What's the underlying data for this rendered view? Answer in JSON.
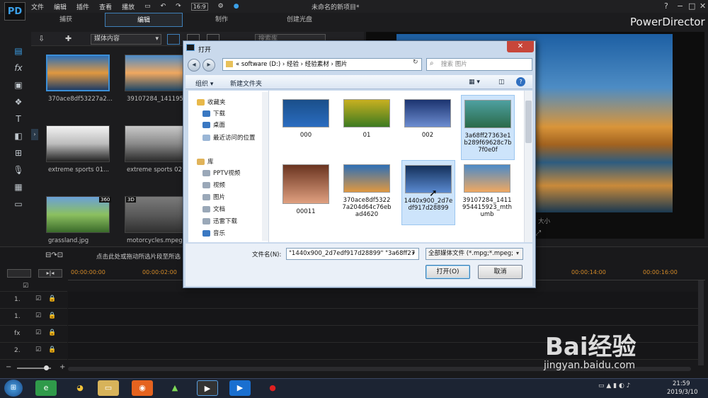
{
  "menubar": {
    "items": [
      "文件",
      "编辑",
      "插件",
      "查看",
      "播放"
    ],
    "title": "未命名的新项目*",
    "zoom_value": "16:9",
    "help": "?",
    "minimize": "−",
    "maximize": "□",
    "close": "✕"
  },
  "modes": [
    "捕获",
    "编辑",
    "制作",
    "创建光盘"
  ],
  "brand": "PowerDirector",
  "library": {
    "filter": "媒体内容",
    "search_placeholder": "搜索库",
    "items": [
      {
        "label": "370ace8df53227a2...",
        "colors": [
          "#2e6fb6",
          "#e09840",
          "#1f3d66"
        ]
      },
      {
        "label": "39107284_1411954...",
        "colors": [
          "#4b8ac8",
          "#f0a860",
          "#1e4666"
        ]
      },
      {
        "label": "extreme sports 01...",
        "colors": [
          "#f2f2f2",
          "#bcbcbc",
          "#222"
        ]
      },
      {
        "label": "extreme sports 02...",
        "colors": [
          "#c9c9c9",
          "#8a8a8a",
          "#2a2a2a"
        ]
      },
      {
        "label": "grassland.jpg",
        "colors": [
          "#6aa0d8",
          "#8cc060",
          "#3a6a2a"
        ]
      },
      {
        "label": "motorcycles.mpeg",
        "colors": [
          "#7a7a7a",
          "#5a5a5a",
          "#303030"
        ]
      }
    ],
    "badges": [
      "360",
      "3D"
    ]
  },
  "preview": {
    "size_label": "大小"
  },
  "timeline": {
    "hint": "点击此处或拖动所选片段至所选",
    "ticks": [
      {
        "label": "00:00:00:00",
        "pos": 0
      },
      {
        "label": "00:00:02:00",
        "pos": 1
      },
      {
        "label": "00:00:14:00",
        "pos": 7
      },
      {
        "label": "00:00:16:00",
        "pos": 8
      }
    ],
    "tracks": [
      "1.",
      "1.",
      "fx",
      "2."
    ]
  },
  "dialog": {
    "title": "打开",
    "address": "« software (D:) › 经验 › 经验素材 › 图片",
    "search_placeholder": "搜索 图片",
    "organize": "组织 ▾",
    "new_folder": "新建文件夹",
    "nav": [
      {
        "label": "收藏夹",
        "color": "#e8b84a"
      },
      {
        "label": "下载",
        "color": "#3a78c2"
      },
      {
        "label": "桌面",
        "color": "#3a78c2"
      },
      {
        "label": "最近访问的位置",
        "color": "#9ab6d6"
      },
      {
        "label": "库",
        "color": "#e0b35a"
      },
      {
        "label": "PPTV视频",
        "color": "#9aa8b8"
      },
      {
        "label": "视频",
        "color": "#9aa8b8"
      },
      {
        "label": "图片",
        "color": "#9aa8b8"
      },
      {
        "label": "文档",
        "color": "#9aa8b8"
      },
      {
        "label": "迅雷下载",
        "color": "#9aa8b8"
      },
      {
        "label": "音乐",
        "color": "#3a78c2"
      }
    ],
    "files": [
      {
        "name": "000",
        "colors": [
          "#1a4f8a",
          "#2a6cc0"
        ],
        "selected": false
      },
      {
        "name": "01",
        "colors": [
          "#c8b020",
          "#3c7a20"
        ],
        "selected": false
      },
      {
        "name": "002",
        "colors": [
          "#1c3470",
          "#6c8cd0"
        ],
        "selected": false
      },
      {
        "name": "3a68ff27363e1b289f69628c7b7f0e0f",
        "colors": [
          "#4ea0a0",
          "#2a6a4a"
        ],
        "selected": true
      },
      {
        "name": "00011",
        "colors": [
          "#6a3420",
          "#e0a080"
        ],
        "selected": false
      },
      {
        "name": "370ace8df53227a204d64c76ebad4620",
        "colors": [
          "#2e6fb6",
          "#e09840"
        ],
        "selected": false
      },
      {
        "name": "1440x900_2d7edf917d28899",
        "colors": [
          "#14305a",
          "#5a8ad0"
        ],
        "selected": true
      },
      {
        "name": "39107284_1411954415923_mthumb",
        "colors": [
          "#4b8ac8",
          "#f0a860"
        ],
        "selected": false
      }
    ],
    "filename_label": "文件名(N):",
    "filename_value": "\"1440x900_2d7edf917d28899\" \"3a68ff27",
    "filetype_value": "全部媒体文件 (*.mpg;*.mpeg;",
    "open_label": "打开(O)",
    "cancel_label": "取消",
    "close_label": "✕"
  },
  "taskbar": {
    "time": "21:59",
    "date": "2019/3/10"
  },
  "watermark": {
    "logo": "Bai经验",
    "url": "jingyan.baidu.com"
  }
}
